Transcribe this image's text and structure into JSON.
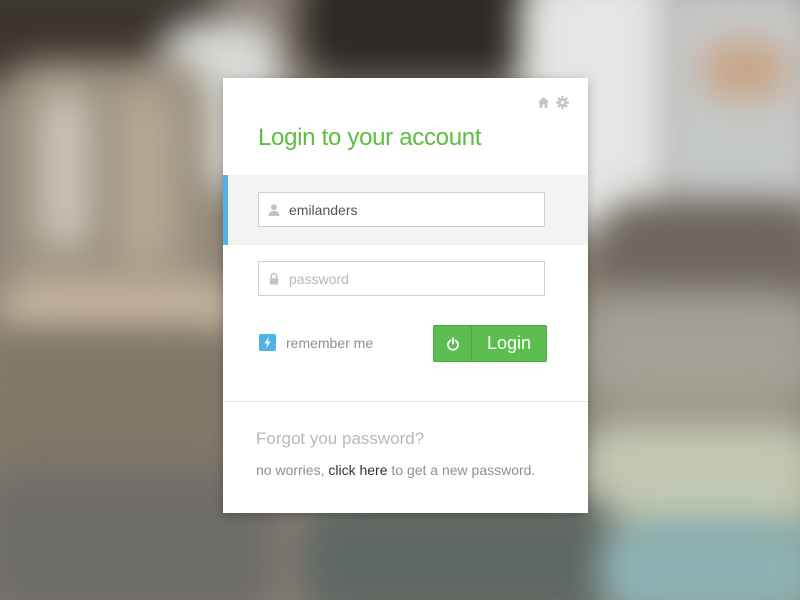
{
  "header": {
    "title": "Login to your account",
    "icons": [
      "home-icon",
      "gear-icon"
    ]
  },
  "form": {
    "username": {
      "value": "emilanders",
      "icon": "user-icon"
    },
    "password": {
      "value": "",
      "placeholder": "password",
      "icon": "lock-icon"
    },
    "remember_label": "remember me",
    "remember_checked": true,
    "login_label": "Login",
    "login_icon": "power-icon"
  },
  "forgot": {
    "title": "Forgot you password?",
    "text_before": "no worries, ",
    "link": "click here",
    "text_after": " to get a new password."
  },
  "colors": {
    "accent_green": "#5cbe3c",
    "button_green": "#5cbe51",
    "accent_blue": "#4fb3e6"
  }
}
